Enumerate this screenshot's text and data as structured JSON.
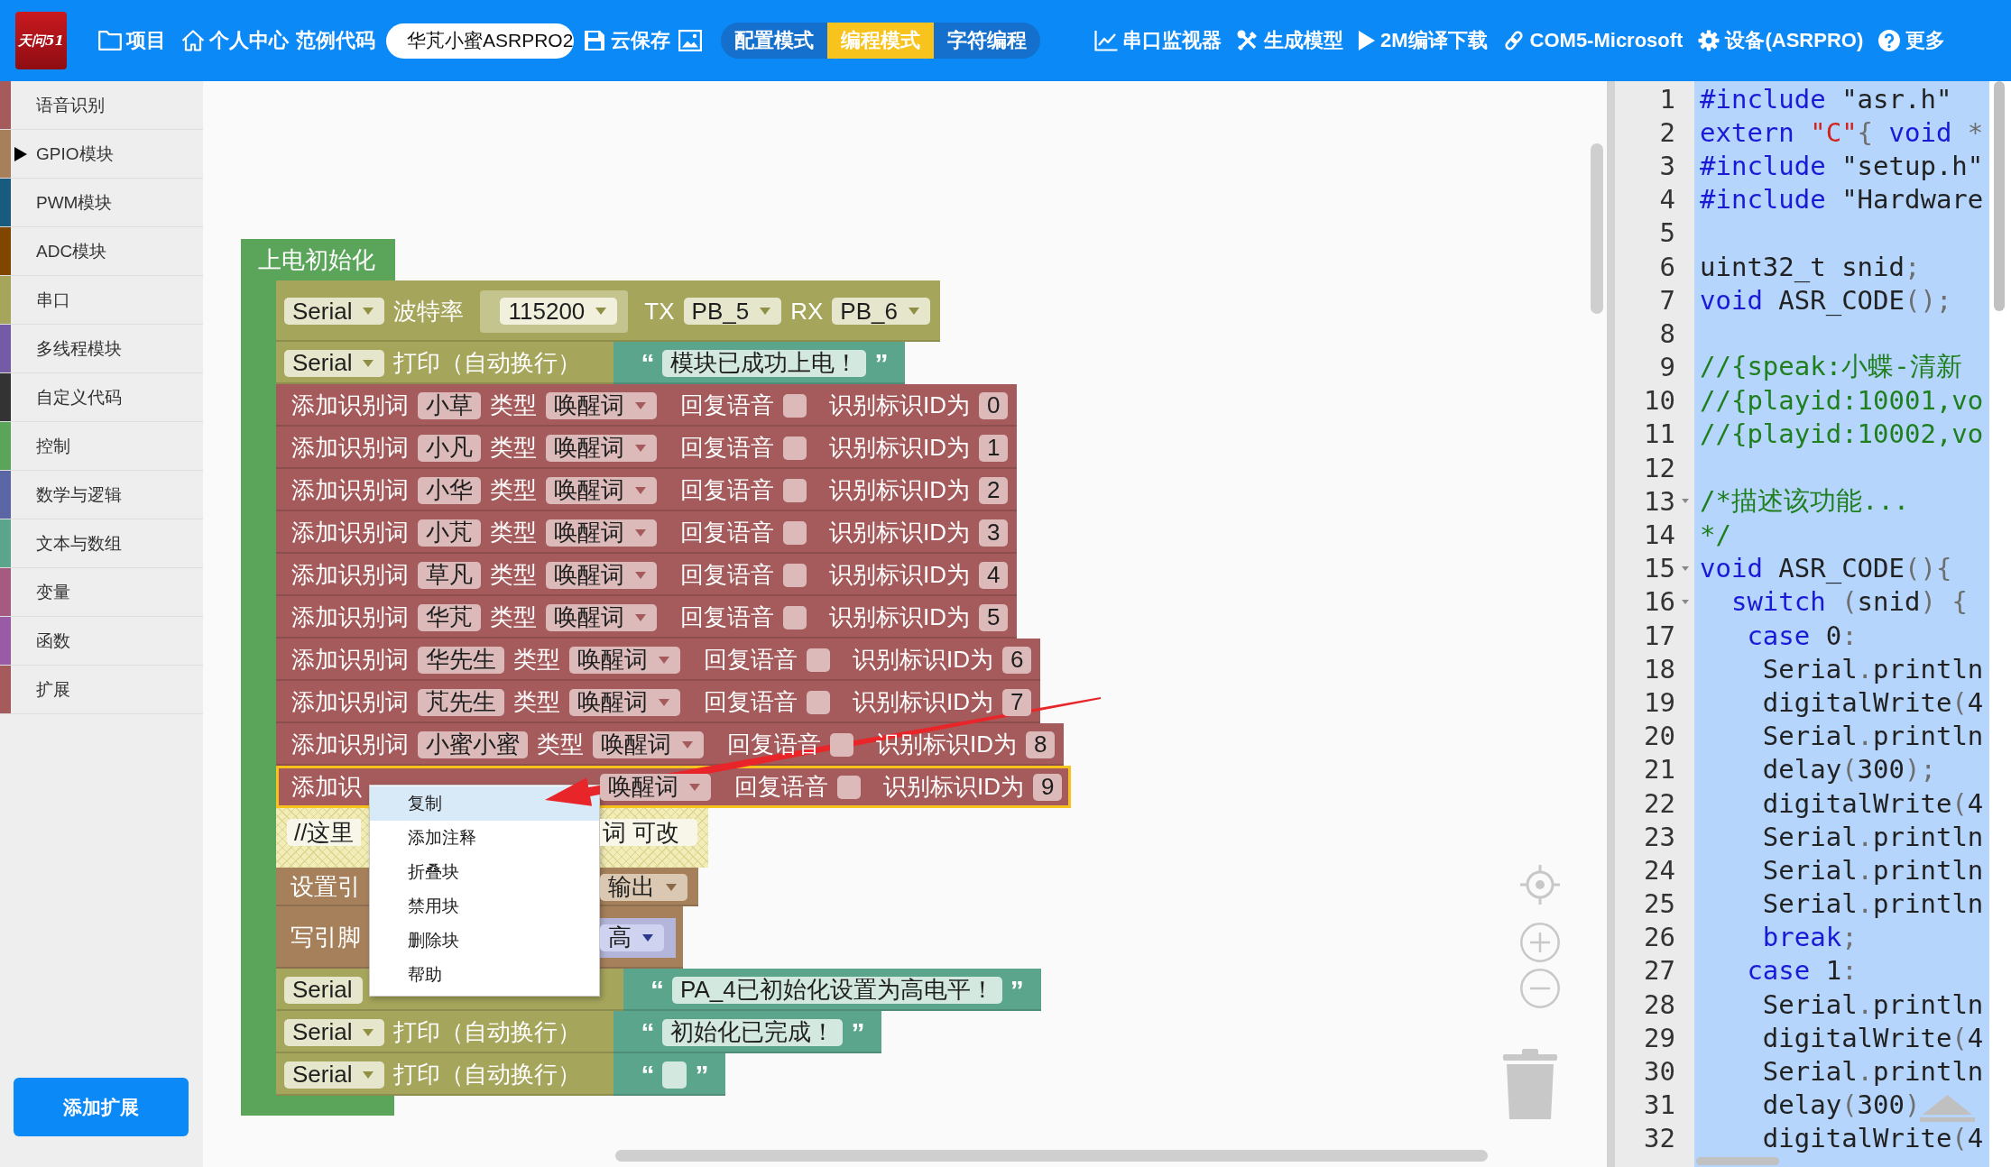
{
  "toolbar": {
    "logo": "天问51",
    "project": "项目",
    "profile": "个人中心",
    "examples": "范例代码",
    "project_name": "华芃小蜜ASRPRO2",
    "cloud_save": "云保存",
    "modes": [
      {
        "label": "配置模式",
        "selected": false
      },
      {
        "label": "编程模式",
        "selected": true
      },
      {
        "label": "字符编程",
        "selected": false
      }
    ],
    "serial_monitor": "串口监视器",
    "build_model": "生成模型",
    "compile": "2M编译下载",
    "port": "COM5-Microsoft",
    "device": "设备(ASRPRO)",
    "more": "更多"
  },
  "sidebar": {
    "categories": [
      {
        "label": "语音识别",
        "color": "#a55b5b",
        "collapsed": false
      },
      {
        "label": "GPIO模块",
        "color": "#a5805b",
        "collapsed": true
      },
      {
        "label": "PWM模块",
        "color": "#185b7f",
        "collapsed": false
      },
      {
        "label": "ADC模块",
        "color": "#804600",
        "collapsed": false
      },
      {
        "label": "串口",
        "color": "#a5a55b",
        "collapsed": false
      },
      {
        "label": "多线程模块",
        "color": "#745ba5",
        "collapsed": false
      },
      {
        "label": "自定义代码",
        "color": "#333333",
        "collapsed": false
      },
      {
        "label": "控制",
        "color": "#5ba55b",
        "collapsed": false
      },
      {
        "label": "数学与逻辑",
        "color": "#5b67a5",
        "collapsed": false
      },
      {
        "label": "文本与数组",
        "color": "#5ba58c",
        "collapsed": false
      },
      {
        "label": "变量",
        "color": "#a55b80",
        "collapsed": false
      },
      {
        "label": "函数",
        "color": "#995ba5",
        "collapsed": false
      },
      {
        "label": "扩展",
        "color": "#a55b5b",
        "collapsed": false
      }
    ],
    "add_button": "添加扩展"
  },
  "workspace": {
    "event_block": {
      "label": "上电初始化",
      "statements": [
        {
          "kind": "serial_begin",
          "selected": false,
          "port": "Serial",
          "baud_label": "波特率",
          "baud": "115200",
          "tx_label": "TX",
          "tx": "PB_5",
          "rx_label": "RX",
          "rx": "PB_6"
        },
        {
          "kind": "serial_print",
          "selected": false,
          "port": "Serial",
          "label": "打印（自动换行）",
          "text": {
            "open": "“",
            "value": "模块已成功上电！",
            "close": "”"
          }
        },
        {
          "kind": "add_word",
          "selected": false,
          "label": "添加识别词",
          "word": "小草",
          "type_label": "类型",
          "type": "唤醒词",
          "reply_label": "回复语音",
          "reply": false,
          "id_label": "识别标识ID为",
          "id": "0"
        },
        {
          "kind": "add_word",
          "selected": false,
          "label": "添加识别词",
          "word": "小凡",
          "type_label": "类型",
          "type": "唤醒词",
          "reply_label": "回复语音",
          "reply": false,
          "id_label": "识别标识ID为",
          "id": "1"
        },
        {
          "kind": "add_word",
          "selected": false,
          "label": "添加识别词",
          "word": "小华",
          "type_label": "类型",
          "type": "唤醒词",
          "reply_label": "回复语音",
          "reply": false,
          "id_label": "识别标识ID为",
          "id": "2"
        },
        {
          "kind": "add_word",
          "selected": false,
          "label": "添加识别词",
          "word": "小芃",
          "type_label": "类型",
          "type": "唤醒词",
          "reply_label": "回复语音",
          "reply": false,
          "id_label": "识别标识ID为",
          "id": "3"
        },
        {
          "kind": "add_word",
          "selected": false,
          "label": "添加识别词",
          "word": "草凡",
          "type_label": "类型",
          "type": "唤醒词",
          "reply_label": "回复语音",
          "reply": false,
          "id_label": "识别标识ID为",
          "id": "4"
        },
        {
          "kind": "add_word",
          "selected": false,
          "label": "添加识别词",
          "word": "华芃",
          "type_label": "类型",
          "type": "唤醒词",
          "reply_label": "回复语音",
          "reply": false,
          "id_label": "识别标识ID为",
          "id": "5"
        },
        {
          "kind": "add_word",
          "selected": false,
          "label": "添加识别词",
          "word": "华先生",
          "type_label": "类型",
          "type": "唤醒词",
          "reply_label": "回复语音",
          "reply": false,
          "id_label": "识别标识ID为",
          "id": "6"
        },
        {
          "kind": "add_word",
          "selected": false,
          "label": "添加识别词",
          "word": "芃先生",
          "type_label": "类型",
          "type": "唤醒词",
          "reply_label": "回复语音",
          "reply": false,
          "id_label": "识别标识ID为",
          "id": "7"
        },
        {
          "kind": "add_word",
          "selected": false,
          "label": "添加识别词",
          "word": "小蜜小蜜",
          "type_label": "类型",
          "type": "唤醒词",
          "reply_label": "回复语音",
          "reply": false,
          "id_label": "识别标识ID为",
          "id": "8"
        },
        {
          "kind": "add_word",
          "selected": true,
          "label": "添加识",
          "type": "唤醒词",
          "reply_label": "回复语音",
          "reply": false,
          "id_label": "识别标识ID为",
          "id": "9"
        },
        {
          "kind": "comment",
          "selected": false,
          "text_start": "//这里",
          "text_end": "词 可改"
        },
        {
          "kind": "pin_mode",
          "selected": false,
          "label": "设置引",
          "mode": "输出"
        },
        {
          "kind": "digital_write",
          "selected": false,
          "label": "写引脚",
          "value": "高"
        },
        {
          "kind": "serial_print",
          "selected": false,
          "port": "Serial",
          "text": {
            "open": "“",
            "value": "PA_4已初始化设置为高电平！",
            "close": "”"
          }
        },
        {
          "kind": "serial_print",
          "selected": false,
          "port": "Serial",
          "label": "打印（自动换行）",
          "text": {
            "open": "“",
            "value": "初始化已完成！",
            "close": "”"
          }
        },
        {
          "kind": "serial_print",
          "selected": false,
          "port": "Serial",
          "label": "打印（自动换行）",
          "text": {
            "open": "“",
            "close": "”"
          }
        }
      ]
    },
    "context_menu": {
      "items": [
        {
          "label": "复制",
          "selected": true
        },
        {
          "label": "添加注释",
          "selected": false
        },
        {
          "label": "折叠块",
          "selected": false
        },
        {
          "label": "禁用块",
          "selected": false
        },
        {
          "label": "删除块",
          "selected": false
        },
        {
          "label": "帮助",
          "selected": false
        }
      ]
    }
  },
  "code_editor": {
    "lines": [
      {
        "number": "1",
        "fold": false,
        "tokens": [
          {
            "kind": "keyword",
            "text": "#include"
          },
          {
            "kind": "plain",
            "text": " \"asr.h\""
          }
        ]
      },
      {
        "number": "2",
        "fold": false,
        "tokens": [
          {
            "kind": "keyword",
            "text": "extern"
          },
          {
            "kind": "string",
            "text": " \"C\""
          },
          {
            "kind": "punct",
            "text": "{"
          },
          {
            "kind": "keyword",
            "text": " void"
          },
          {
            "kind": "punct",
            "text": " *"
          }
        ]
      },
      {
        "number": "3",
        "fold": false,
        "tokens": [
          {
            "kind": "keyword",
            "text": "#include"
          },
          {
            "kind": "plain",
            "text": " \"setup.h\""
          }
        ]
      },
      {
        "number": "4",
        "fold": false,
        "tokens": [
          {
            "kind": "keyword",
            "text": "#include"
          },
          {
            "kind": "plain",
            "text": " \"Hardware"
          }
        ]
      },
      {
        "number": "5",
        "fold": false
      },
      {
        "number": "6",
        "fold": false,
        "tokens": [
          {
            "kind": "plain",
            "text": "uint32_t snid"
          },
          {
            "kind": "punct",
            "text": ";"
          }
        ]
      },
      {
        "number": "7",
        "fold": false,
        "tokens": [
          {
            "kind": "keyword",
            "text": "void"
          },
          {
            "kind": "plain",
            "text": " ASR_CODE"
          },
          {
            "kind": "punct",
            "text": "();"
          }
        ]
      },
      {
        "number": "8",
        "fold": false
      },
      {
        "number": "9",
        "fold": false,
        "tokens": [
          {
            "kind": "comment",
            "text": "//{speak:小蝶-清新"
          }
        ]
      },
      {
        "number": "10",
        "fold": false,
        "tokens": [
          {
            "kind": "comment",
            "text": "//{playid:10001,vo"
          }
        ]
      },
      {
        "number": "11",
        "fold": false,
        "tokens": [
          {
            "kind": "comment",
            "text": "//{playid:10002,vo"
          }
        ]
      },
      {
        "number": "12",
        "fold": false
      },
      {
        "number": "13",
        "fold": true,
        "tokens": [
          {
            "kind": "comment",
            "text": "/*描述该功能..."
          }
        ]
      },
      {
        "number": "14",
        "fold": false,
        "tokens": [
          {
            "kind": "comment",
            "text": "*/"
          }
        ]
      },
      {
        "number": "15",
        "fold": true,
        "tokens": [
          {
            "kind": "keyword",
            "text": "void"
          },
          {
            "kind": "plain",
            "text": " ASR_CODE"
          },
          {
            "kind": "punct",
            "text": "(){"
          }
        ]
      },
      {
        "number": "16",
        "fold": true,
        "tokens": [
          {
            "kind": "keyword",
            "text": "  switch"
          },
          {
            "kind": "punct",
            "text": " ("
          },
          {
            "kind": "plain",
            "text": "snid"
          },
          {
            "kind": "punct",
            "text": ")"
          },
          {
            "kind": "punct",
            "text": " {"
          }
        ]
      },
      {
        "number": "17",
        "fold": false,
        "tokens": [
          {
            "kind": "keyword",
            "text": "   case"
          },
          {
            "kind": "plain",
            "text": " 0"
          },
          {
            "kind": "punct",
            "text": ":"
          }
        ]
      },
      {
        "number": "18",
        "fold": false,
        "tokens": [
          {
            "kind": "plain",
            "text": "    Serial"
          },
          {
            "kind": "punct",
            "text": "."
          },
          {
            "kind": "plain",
            "text": "println"
          }
        ]
      },
      {
        "number": "19",
        "fold": false,
        "tokens": [
          {
            "kind": "plain",
            "text": "    digitalWrite"
          },
          {
            "kind": "punct",
            "text": "("
          },
          {
            "kind": "plain",
            "text": "4"
          }
        ]
      },
      {
        "number": "20",
        "fold": false,
        "tokens": [
          {
            "kind": "plain",
            "text": "    Serial"
          },
          {
            "kind": "punct",
            "text": "."
          },
          {
            "kind": "plain",
            "text": "println"
          }
        ]
      },
      {
        "number": "21",
        "fold": false,
        "tokens": [
          {
            "kind": "plain",
            "text": "    delay"
          },
          {
            "kind": "punct",
            "text": "("
          },
          {
            "kind": "plain",
            "text": "300"
          },
          {
            "kind": "punct",
            "text": ");"
          }
        ]
      },
      {
        "number": "22",
        "fold": false,
        "tokens": [
          {
            "kind": "plain",
            "text": "    digitalWrite"
          },
          {
            "kind": "punct",
            "text": "("
          },
          {
            "kind": "plain",
            "text": "4"
          }
        ]
      },
      {
        "number": "23",
        "fold": false,
        "tokens": [
          {
            "kind": "plain",
            "text": "    Serial"
          },
          {
            "kind": "punct",
            "text": "."
          },
          {
            "kind": "plain",
            "text": "println"
          }
        ]
      },
      {
        "number": "24",
        "fold": false,
        "tokens": [
          {
            "kind": "plain",
            "text": "    Serial"
          },
          {
            "kind": "punct",
            "text": "."
          },
          {
            "kind": "plain",
            "text": "println"
          }
        ]
      },
      {
        "number": "25",
        "fold": false,
        "tokens": [
          {
            "kind": "plain",
            "text": "    Serial"
          },
          {
            "kind": "punct",
            "text": "."
          },
          {
            "kind": "plain",
            "text": "println"
          }
        ]
      },
      {
        "number": "26",
        "fold": false,
        "tokens": [
          {
            "kind": "keyword",
            "text": "    break"
          },
          {
            "kind": "punct",
            "text": ";"
          }
        ]
      },
      {
        "number": "27",
        "fold": false,
        "tokens": [
          {
            "kind": "keyword",
            "text": "   case"
          },
          {
            "kind": "plain",
            "text": " 1"
          },
          {
            "kind": "punct",
            "text": ":"
          }
        ]
      },
      {
        "number": "28",
        "fold": false,
        "tokens": [
          {
            "kind": "plain",
            "text": "    Serial"
          },
          {
            "kind": "punct",
            "text": "."
          },
          {
            "kind": "plain",
            "text": "println"
          }
        ]
      },
      {
        "number": "29",
        "fold": false,
        "tokens": [
          {
            "kind": "plain",
            "text": "    digitalWrite"
          },
          {
            "kind": "punct",
            "text": "("
          },
          {
            "kind": "plain",
            "text": "4"
          }
        ]
      },
      {
        "number": "30",
        "fold": false,
        "tokens": [
          {
            "kind": "plain",
            "text": "    Serial"
          },
          {
            "kind": "punct",
            "text": "."
          },
          {
            "kind": "plain",
            "text": "println"
          }
        ]
      },
      {
        "number": "31",
        "fold": false,
        "tokens": [
          {
            "kind": "plain",
            "text": "    delay"
          },
          {
            "kind": "punct",
            "text": "("
          },
          {
            "kind": "plain",
            "text": "300"
          },
          {
            "kind": "punct",
            "text": ")"
          }
        ]
      },
      {
        "number": "32",
        "fold": false,
        "tokens": [
          {
            "kind": "plain",
            "text": "    digitalWrite"
          },
          {
            "kind": "punct",
            "text": "("
          },
          {
            "kind": "plain",
            "text": "4"
          }
        ]
      }
    ]
  }
}
